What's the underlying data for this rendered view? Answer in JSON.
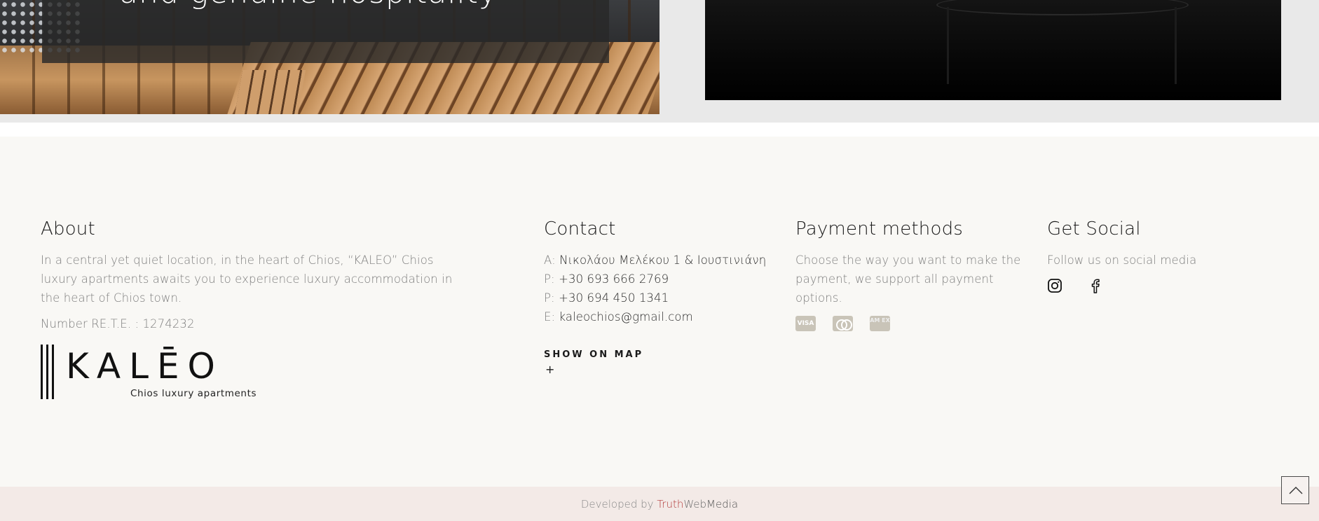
{
  "hero": {
    "caption": "and genuine hospitality"
  },
  "footer": {
    "about": {
      "heading": "About",
      "text": "In a central yet quiet location, in the heart of Chios, “KALEO” Chios luxury apartments awaits you to experience luxury accommodation in the heart of Chios town.",
      "rete": "Number RE.T.E. : 1274232",
      "logo_word": "KALĒO",
      "logo_sub": "Chios luxury apartments"
    },
    "contact": {
      "heading": "Contact",
      "address_label": "A:",
      "address": "Νικολάου Μελέκου 1 & Ιουστινιάνη",
      "phone1_label": "P:",
      "phone1": "+30 693 666 2769",
      "phone2_label": "P:",
      "phone2": "+30 694 450 1341",
      "email_label": "E:",
      "email": "kaleochios@gmail.com",
      "map_link": "SHOW ON MAP",
      "map_plus": "+"
    },
    "payment": {
      "heading": "Payment methods",
      "text": "Choose the way you want to make the payment, we support all payment options.",
      "cards": [
        {
          "name": "visa-icon",
          "label": "VISA"
        },
        {
          "name": "mastercard-icon",
          "label": ""
        },
        {
          "name": "amex-icon",
          "label": "AM EX"
        }
      ]
    },
    "social": {
      "heading": "Get Social",
      "text": "Follow us on social media",
      "icons": [
        "instagram-icon",
        "facebook-icon"
      ]
    }
  },
  "bottom": {
    "credit_prefix": "Developed by ",
    "brand_a": "Truth",
    "brand_b": "Web",
    "brand_c": "Media"
  },
  "colors": {
    "footer_bg": "#f9f8f5",
    "bottom_bar_bg": "#f3eae7",
    "brand_accent": "#b23a3a",
    "card_gray": "#c9c4b8"
  }
}
